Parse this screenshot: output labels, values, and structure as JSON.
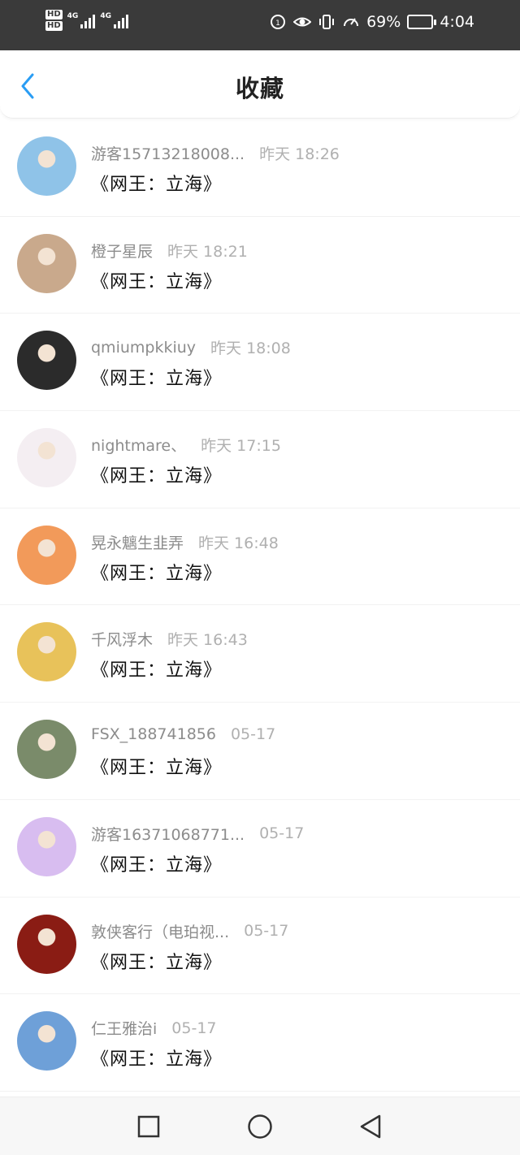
{
  "status_bar": {
    "hd1": "HD",
    "hd2": "HD",
    "net1": "4G",
    "net2": "4G",
    "battery_text": "69%",
    "battery_level": 0.69,
    "time": "4:04"
  },
  "header": {
    "title": "收藏",
    "back_icon": "chevron-left-icon",
    "accent_color": "#2a9df4"
  },
  "favorites": [
    {
      "user": "游客15713218008...",
      "time": "昨天 18:26",
      "work": "《网王：立海》",
      "avatar_color": "#8fc3e8"
    },
    {
      "user": "橙子星辰",
      "time": "昨天 18:21",
      "work": "《网王：立海》",
      "avatar_color": "#c9a98c"
    },
    {
      "user": "qmiumpkkiuy",
      "time": "昨天 18:08",
      "work": "《网王：立海》",
      "avatar_color": "#2b2b2b"
    },
    {
      "user": "nightmare、",
      "time": "昨天 17:15",
      "work": "《网王：立海》",
      "avatar_color": "#f4eef2"
    },
    {
      "user": "晃永魑生韭弄",
      "time": "昨天 16:48",
      "work": "《网王：立海》",
      "avatar_color": "#f29a5a"
    },
    {
      "user": "千风浮木",
      "time": "昨天 16:43",
      "work": "《网王：立海》",
      "avatar_color": "#e8c25a"
    },
    {
      "user": "FSX_188741856",
      "time": "05-17",
      "work": "《网王：立海》",
      "avatar_color": "#7a8b6a"
    },
    {
      "user": "游客16371068771...",
      "time": "05-17",
      "work": "《网王：立海》",
      "avatar_color": "#d8bdf0"
    },
    {
      "user": "敦侠客行（电珀视...",
      "time": "05-17",
      "work": "《网王：立海》",
      "avatar_color": "#8a1c14"
    },
    {
      "user": "仁王雅治i",
      "time": "05-17",
      "work": "《网王：立海》",
      "avatar_color": "#6ea0d8"
    }
  ],
  "nav_bar": {
    "recents_icon": "square-icon",
    "home_icon": "circle-icon",
    "back_icon": "triangle-back-icon"
  }
}
